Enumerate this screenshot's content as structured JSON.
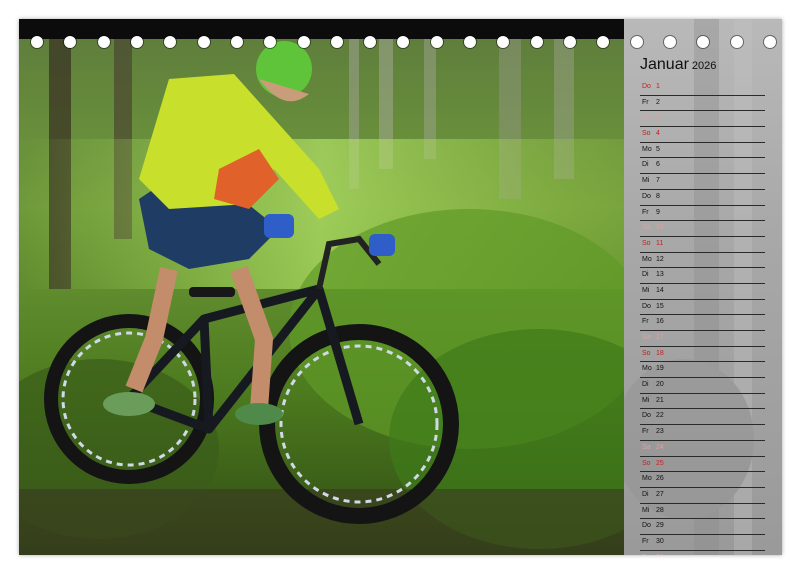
{
  "month": "Januar",
  "year": "2026",
  "days": [
    {
      "wd": "Do",
      "dn": "1",
      "kind": "hol"
    },
    {
      "wd": "Fr",
      "dn": "2",
      "kind": "normal"
    },
    {
      "wd": "Sa",
      "dn": "3",
      "kind": "sat"
    },
    {
      "wd": "So",
      "dn": "4",
      "kind": "sun"
    },
    {
      "wd": "Mo",
      "dn": "5",
      "kind": "normal"
    },
    {
      "wd": "Di",
      "dn": "6",
      "kind": "normal"
    },
    {
      "wd": "Mi",
      "dn": "7",
      "kind": "normal"
    },
    {
      "wd": "Do",
      "dn": "8",
      "kind": "normal"
    },
    {
      "wd": "Fr",
      "dn": "9",
      "kind": "normal"
    },
    {
      "wd": "Sa",
      "dn": "10",
      "kind": "sat"
    },
    {
      "wd": "So",
      "dn": "11",
      "kind": "sun"
    },
    {
      "wd": "Mo",
      "dn": "12",
      "kind": "normal"
    },
    {
      "wd": "Di",
      "dn": "13",
      "kind": "normal"
    },
    {
      "wd": "Mi",
      "dn": "14",
      "kind": "normal"
    },
    {
      "wd": "Do",
      "dn": "15",
      "kind": "normal"
    },
    {
      "wd": "Fr",
      "dn": "16",
      "kind": "normal"
    },
    {
      "wd": "Sa",
      "dn": "17",
      "kind": "sat"
    },
    {
      "wd": "So",
      "dn": "18",
      "kind": "sun"
    },
    {
      "wd": "Mo",
      "dn": "19",
      "kind": "normal"
    },
    {
      "wd": "Di",
      "dn": "20",
      "kind": "normal"
    },
    {
      "wd": "Mi",
      "dn": "21",
      "kind": "normal"
    },
    {
      "wd": "Do",
      "dn": "22",
      "kind": "normal"
    },
    {
      "wd": "Fr",
      "dn": "23",
      "kind": "normal"
    },
    {
      "wd": "Sa",
      "dn": "24",
      "kind": "sat"
    },
    {
      "wd": "So",
      "dn": "25",
      "kind": "sun"
    },
    {
      "wd": "Mo",
      "dn": "26",
      "kind": "normal"
    },
    {
      "wd": "Di",
      "dn": "27",
      "kind": "normal"
    },
    {
      "wd": "Mi",
      "dn": "28",
      "kind": "normal"
    },
    {
      "wd": "Do",
      "dn": "29",
      "kind": "normal"
    },
    {
      "wd": "Fr",
      "dn": "30",
      "kind": "normal"
    },
    {
      "wd": "Sa",
      "dn": "31",
      "kind": "sat"
    }
  ],
  "colors": {
    "sunday": "#c62020",
    "saturday": "#d8a4a4",
    "text": "#111111"
  }
}
